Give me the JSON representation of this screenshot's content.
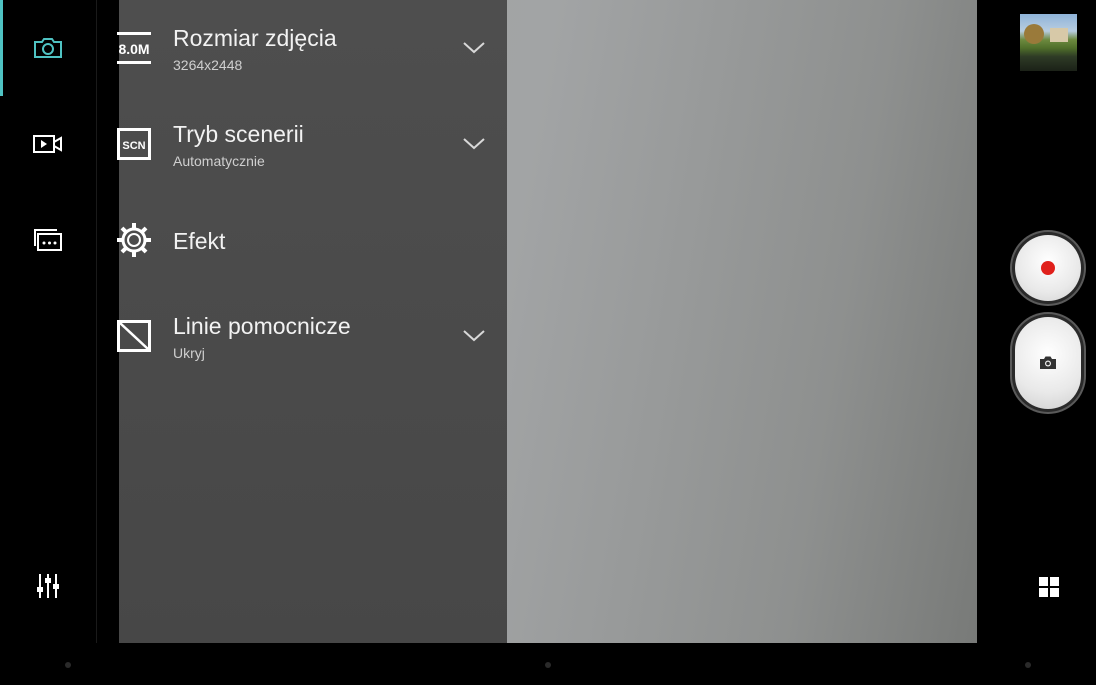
{
  "colors": {
    "accent": "#4fc3c3",
    "record": "#e0201b",
    "panel": "#4b4b4b"
  },
  "rail": {
    "items": [
      {
        "name": "photo-mode",
        "icon": "camera-icon",
        "active": true
      },
      {
        "name": "video-mode",
        "icon": "video-camera-icon",
        "active": false
      },
      {
        "name": "gallery-mode",
        "icon": "gallery-icon",
        "active": false
      }
    ],
    "settings_icon": "sliders-icon"
  },
  "settings": {
    "photo_size": {
      "icon_label": "8.0M",
      "title": "Rozmiar zdjęcia",
      "value": "3264x2448"
    },
    "scene_mode": {
      "icon_label": "SCN",
      "title": "Tryb scenerii",
      "value": "Automatycznie"
    },
    "effect": {
      "title": "Efekt"
    },
    "grid_lines": {
      "title": "Linie pomocnicze",
      "value": "Ukryj"
    }
  },
  "right_rail": {
    "thumbnail_icon": "last-photo-thumbnail",
    "record_icon": "record-icon",
    "shutter_icon": "camera-icon",
    "menu_icon": "grid-icon"
  }
}
